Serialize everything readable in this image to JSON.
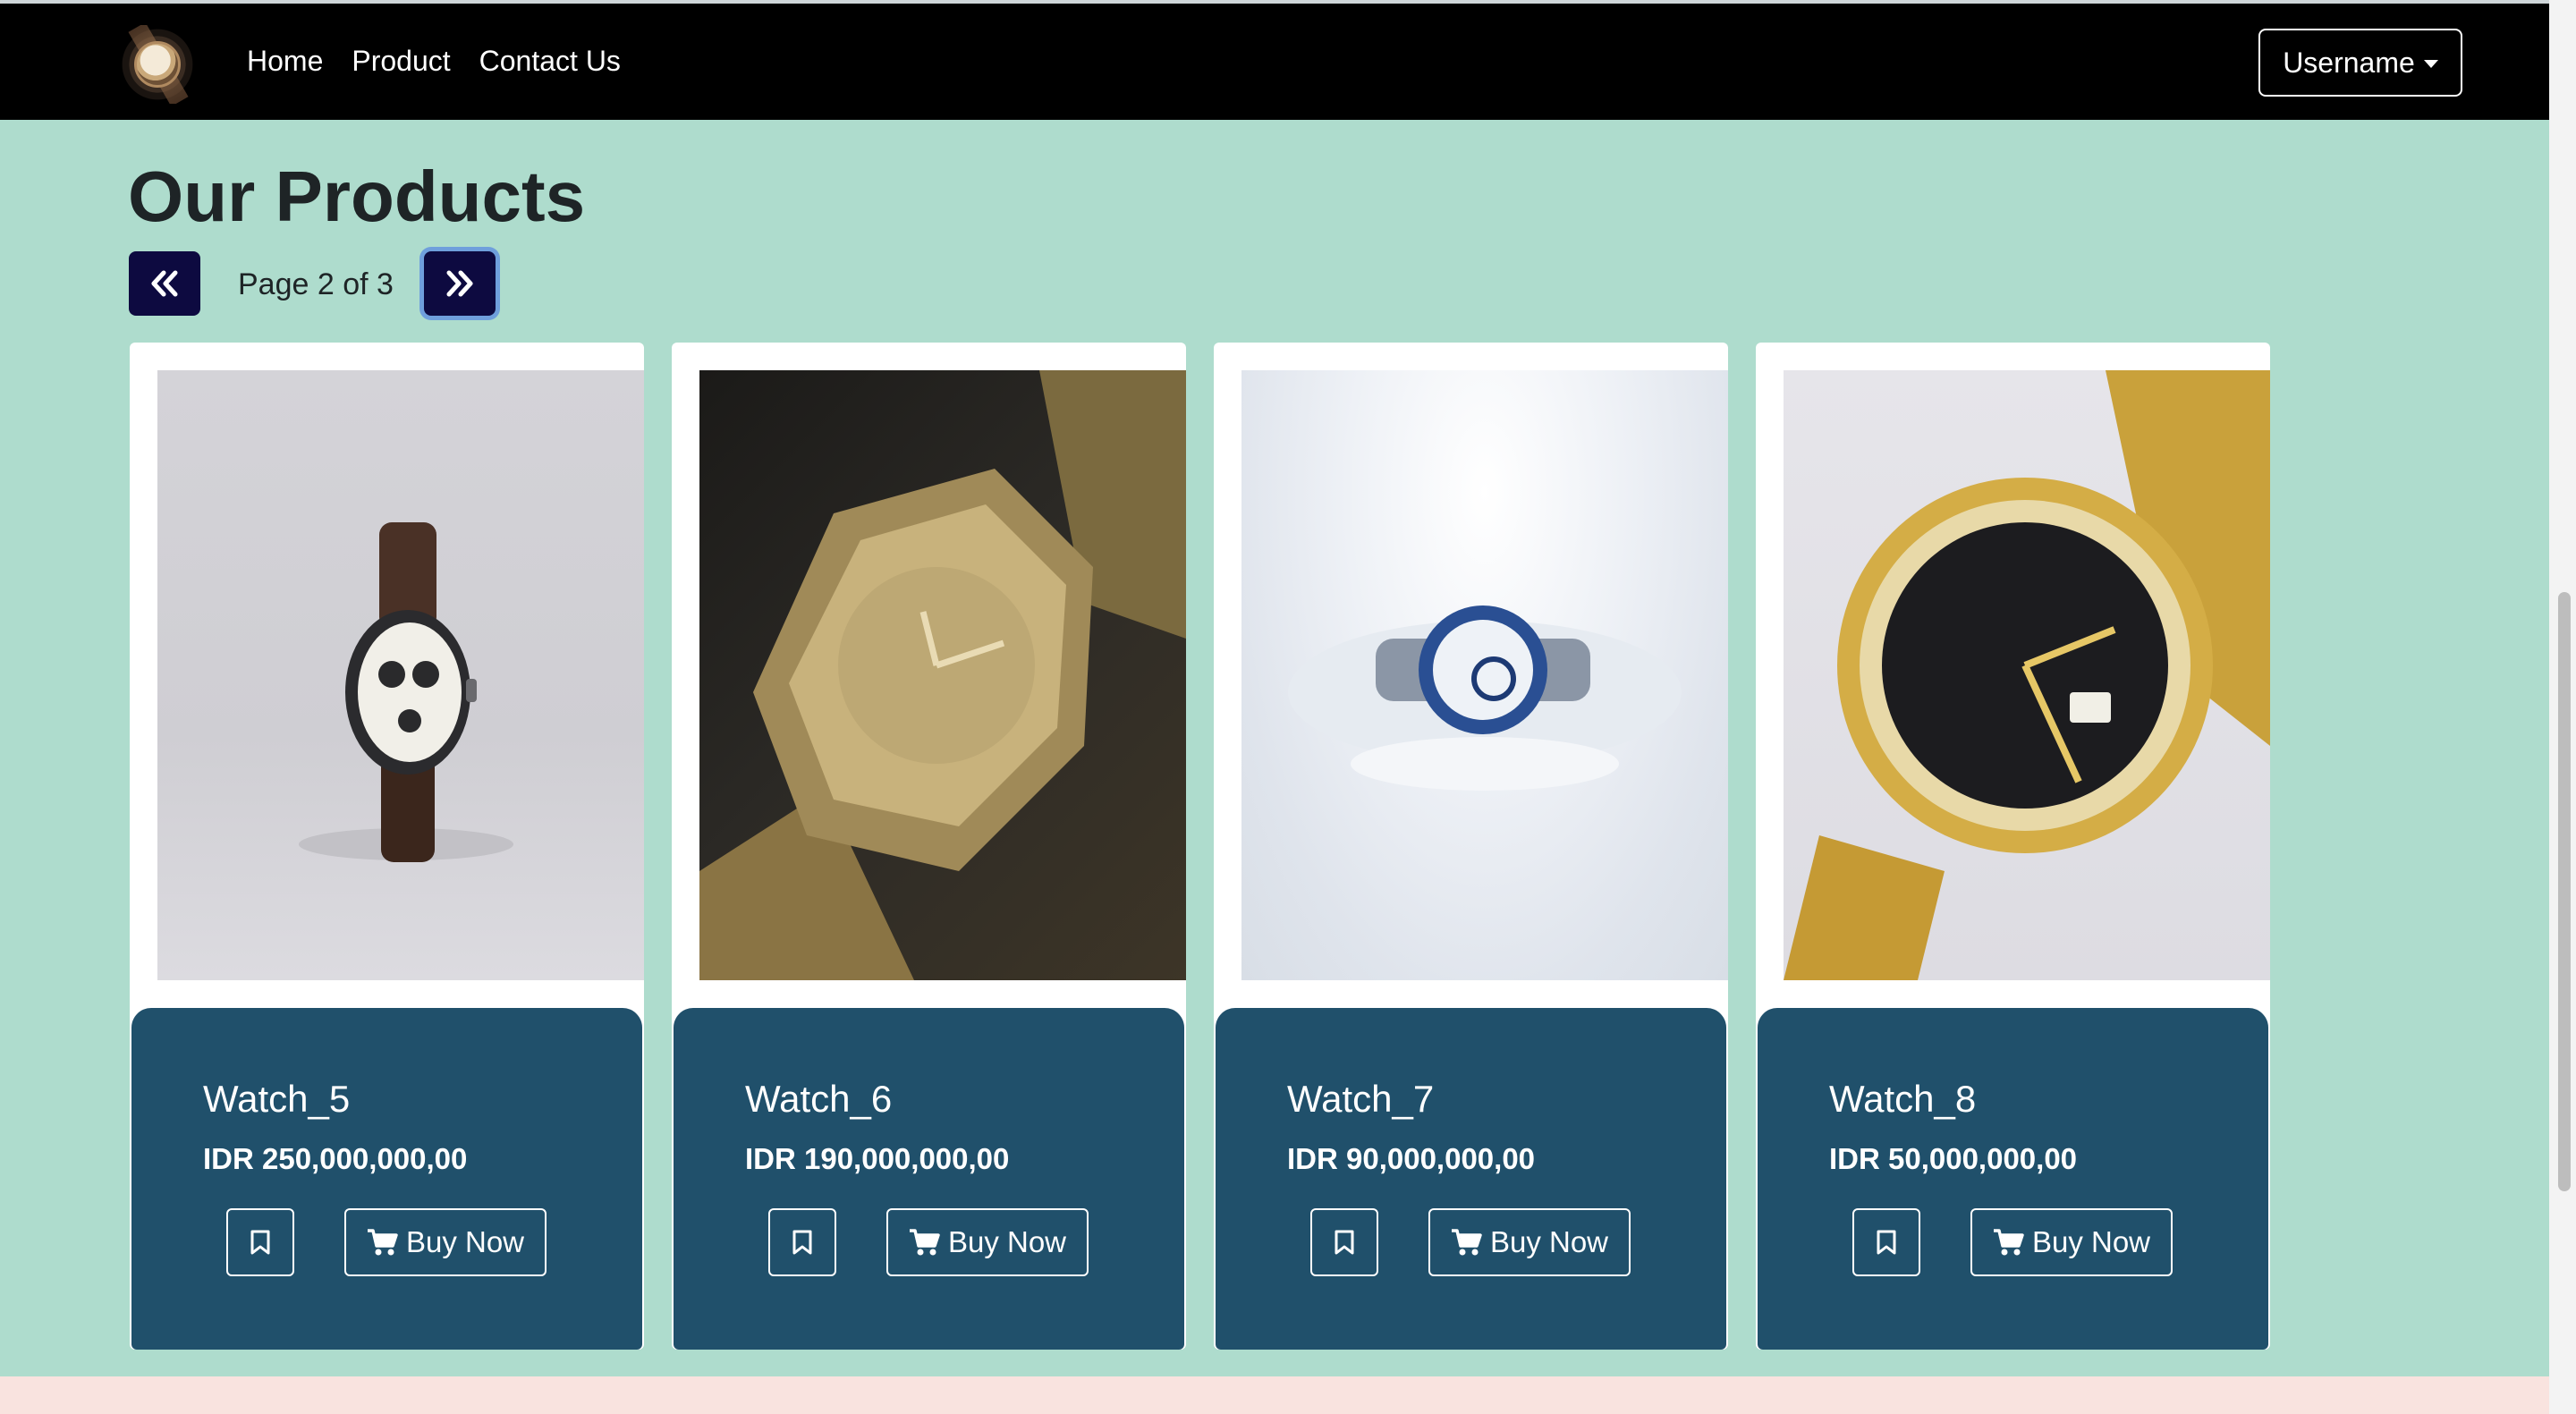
{
  "navbar": {
    "logo_icon": "watch-logo-icon",
    "links": [
      "Home",
      "Product",
      "Contact Us"
    ],
    "user_menu_label": "Username"
  },
  "main": {
    "title": "Our Products",
    "pager": {
      "prev_icon": "double-chevron-left-icon",
      "next_icon": "double-chevron-right-icon",
      "page_text": "Page 2 of 3"
    }
  },
  "products": [
    {
      "name": "Watch_5",
      "price": "IDR 250,000,000,00",
      "buy_label": "Buy Now"
    },
    {
      "name": "Watch_6",
      "price": "IDR 190,000,000,00",
      "buy_label": "Buy Now"
    },
    {
      "name": "Watch_7",
      "price": "IDR 90,000,000,00",
      "buy_label": "Buy Now"
    },
    {
      "name": "Watch_8",
      "price": "IDR 50,000,000,00",
      "buy_label": "Buy Now"
    }
  ],
  "colors": {
    "navbar_bg": "#000000",
    "page_bg": "#aedccd",
    "card_body_bg": "#20506b",
    "pager_button_bg": "#0d0a40",
    "footer_bg": "#f9e3df"
  }
}
